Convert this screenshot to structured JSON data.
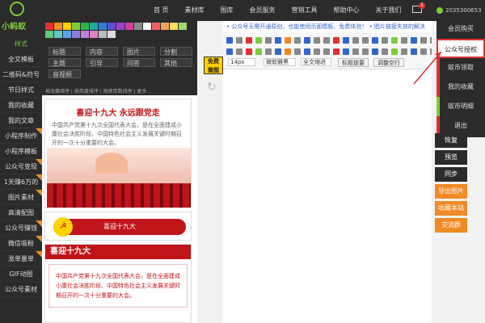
{
  "brand": {
    "name": "小蚂蚁"
  },
  "nav": [
    "首 页",
    "素材库",
    "图库",
    "会员服务",
    "营销工具",
    "帮助中心",
    "关于我们"
  ],
  "user": {
    "id": "2035300653",
    "mail_count": "1"
  },
  "sidebar": {
    "category": "样式",
    "items": [
      {
        "label": "全文模板",
        "new": false
      },
      {
        "label": "二维码&符号",
        "new": false
      },
      {
        "label": "节日样式",
        "new": false
      },
      {
        "label": "我的收藏",
        "new": false
      },
      {
        "label": "我的文章",
        "new": false
      },
      {
        "label": "小程序制作",
        "new": true
      },
      {
        "label": "小程序模板",
        "new": false
      },
      {
        "label": "公众号变现",
        "new": true
      },
      {
        "label": "1天赚6万的",
        "new": true
      },
      {
        "label": "图片素材",
        "new": true
      },
      {
        "label": "高清配图",
        "new": false
      },
      {
        "label": "公众号赚钱",
        "new": true
      },
      {
        "label": "微信吸粉",
        "new": true
      },
      {
        "label": "涨单量单",
        "new": true
      },
      {
        "label": "GIF动图",
        "new": false
      },
      {
        "label": "公众号素材",
        "new": false
      }
    ]
  },
  "panel": {
    "swatch_colors": [
      "#e03030",
      "#f08a24",
      "#ffd200",
      "#7ecb3a",
      "#2eb84a",
      "#20a8a0",
      "#2f7fd8",
      "#5a4fd0",
      "#a03fd0",
      "#d03fa0",
      "#8a8a8a",
      "#ffffff",
      "#f06060",
      "#f4a060",
      "#ffe060",
      "#a0d870",
      "#60c880",
      "#60c8c0",
      "#60a0e8",
      "#8a80e0",
      "#c080e0",
      "#e080c0",
      "#bbbbbb",
      "#dddddd"
    ],
    "categories": [
      "标题",
      "内容",
      "图片",
      "分割",
      "主题",
      "引导",
      "问答",
      "其他",
      "音视频"
    ],
    "subtabs": "按收藏排序 | 按热度排序 | 按使用数排序 | 更多..."
  },
  "free_button": {
    "line1": "免费",
    "line2": "做图"
  },
  "cards": {
    "headline": "喜迎十九大  永远跟党走",
    "para1": "中国共产党第十九次全国代表大会，是在全面建成小康社会决胜阶段、中国特色社会主义发展关键时期召开的一次十分重要的大会。",
    "pill_label": "喜迎十九大",
    "section_title": "喜迎十九大",
    "para2": "中国共产党第十九次全国代表大会，是在全面建成小康社会决胜阶段、中国特色社会主义发展关键时期召开的一次十分重要的大会。"
  },
  "editor": {
    "notice": "• 公众号无需开通原创，也能使用页面模板、免费体验！  • 图片链接失效的解决",
    "font_size": "14px",
    "font_family": "微软雅黑",
    "align": "全文缩进",
    "btn_title": "标题提要",
    "btn_spacing": "调整空行"
  },
  "dropdown": {
    "items": [
      {
        "label": "会员购买",
        "accent": ""
      },
      {
        "label": "公众号授权",
        "accent": "",
        "active": true
      },
      {
        "label": "蚁币领取",
        "accent": "#e03030"
      },
      {
        "label": "我的收藏",
        "accent": "#e03030"
      },
      {
        "label": "蚁币明细",
        "accent": "#7ecb3a"
      },
      {
        "label": "退出",
        "accent": "#e03030"
      }
    ]
  },
  "side_buttons": [
    {
      "label": "恢复",
      "color": "#2b2b2b"
    },
    {
      "label": "预览",
      "color": "#2b2b2b"
    },
    {
      "label": "同步",
      "color": "#2b2b2b"
    },
    {
      "label": "导出图片",
      "color": "#f08a24"
    },
    {
      "label": "收藏本站",
      "color": "#f08a24"
    },
    {
      "label": "交流群",
      "color": "#f08a24"
    }
  ],
  "colors": {
    "accent_red": "#c0141b",
    "dark": "#2b2b2b",
    "green": "#7ecb3a",
    "orange": "#f08a24"
  }
}
